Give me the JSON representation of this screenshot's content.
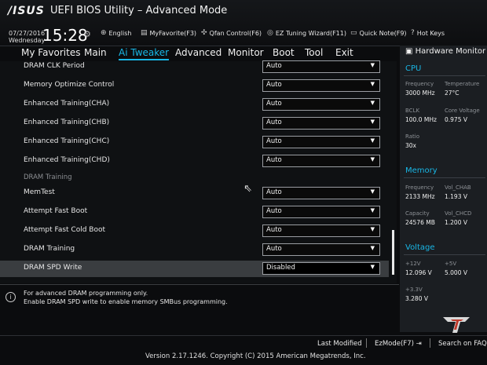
{
  "header": {
    "logo": "/ISUS",
    "title": "UEFI BIOS Utility – Advanced Mode",
    "date": "07/27/2016",
    "day": "Wednesday",
    "time": "15:28",
    "toolbar": [
      {
        "icon": "globe-icon",
        "label": "English"
      },
      {
        "icon": "myfavorite-icon",
        "label": "MyFavorite(F3)"
      },
      {
        "icon": "fan-icon",
        "label": "Qfan Control(F6)"
      },
      {
        "icon": "tuning-icon",
        "label": "EZ Tuning Wizard(F11)"
      },
      {
        "icon": "note-icon",
        "label": "Quick Note(F9)"
      },
      {
        "icon": "help-icon",
        "label": "Hot Keys"
      }
    ]
  },
  "menu": {
    "items": [
      "My Favorites",
      "Main",
      "Ai Tweaker",
      "Advanced",
      "Monitor",
      "Boot",
      "Tool",
      "Exit"
    ],
    "active": "Ai Tweaker"
  },
  "settings": {
    "rows": [
      {
        "label": "DRAM CLK Period",
        "value": "Auto"
      },
      {
        "label": "Memory Optimize Control",
        "value": "Auto"
      },
      {
        "label": "Enhanced Training(CHA)",
        "value": "Auto"
      },
      {
        "label": "Enhanced Training(CHB)",
        "value": "Auto"
      },
      {
        "label": "Enhanced Training(CHC)",
        "value": "Auto"
      },
      {
        "label": "Enhanced Training(CHD)",
        "value": "Auto"
      },
      {
        "label": "MemTest",
        "value": "Auto"
      },
      {
        "label": "Attempt Fast Boot",
        "value": "Auto"
      },
      {
        "label": "Attempt Fast Cold Boot",
        "value": "Auto"
      },
      {
        "label": "DRAM Training",
        "value": "Auto"
      },
      {
        "label": "DRAM SPD Write",
        "value": "Disabled"
      }
    ],
    "section_label": "DRAM Training"
  },
  "help": {
    "line1": "For advanced DRAM programming only.",
    "line2": "Enable DRAM SPD write to enable memory SMBus programming."
  },
  "hardware_monitor": {
    "title": "Hardware Monitor",
    "cpu": {
      "title": "CPU",
      "frequency_label": "Frequency",
      "frequency": "3000 MHz",
      "temperature_label": "Temperature",
      "temperature": "27°C",
      "bclk_label": "BCLK",
      "bclk": "100.0 MHz",
      "core_voltage_label": "Core Voltage",
      "core_voltage": "0.975 V",
      "ratio_label": "Ratio",
      "ratio": "30x"
    },
    "memory": {
      "title": "Memory",
      "frequency_label": "Frequency",
      "frequency": "2133 MHz",
      "vol_chab_label": "Vol_CHAB",
      "vol_chab": "1.193 V",
      "capacity_label": "Capacity",
      "capacity": "24576 MB",
      "vol_chcd_label": "Vol_CHCD",
      "vol_chcd": "1.200 V"
    },
    "voltage": {
      "title": "Voltage",
      "v12_label": "+12V",
      "v12": "12.096 V",
      "v5_label": "+5V",
      "v5": "5.000 V",
      "v33_label": "+3.3V",
      "v33": "3.280 V"
    }
  },
  "footer": {
    "last_modified": "Last Modified",
    "ezmode": "EzMode(F7)",
    "search": "Search on FAQ",
    "version": "Version 2.17.1246. Copyright (C) 2015 American Megatrends, Inc."
  }
}
